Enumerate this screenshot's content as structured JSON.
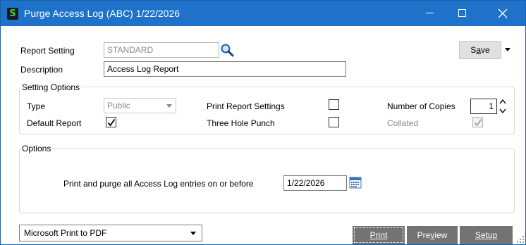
{
  "window": {
    "app_icon_letter": "S",
    "title": "Purge Access Log (ABC) 1/22/2026"
  },
  "report": {
    "setting_label": "Report Setting",
    "setting_value": "STANDARD",
    "description_label": "Description",
    "description_value": "Access Log Report",
    "save_label_prefix": "S",
    "save_label_underline": "a",
    "save_label_suffix": "ve"
  },
  "setting_options": {
    "group_label": "Setting Options",
    "type_label": "Type",
    "type_value": "Public",
    "default_report_label": "Default Report",
    "default_report_checked": true,
    "print_report_settings_label": "Print Report Settings",
    "print_report_settings_checked": false,
    "three_hole_punch_label": "Three Hole Punch",
    "three_hole_punch_checked": false,
    "copies_label": "Number of Copies",
    "copies_value": "1",
    "collated_label": "Collated",
    "collated_checked": true
  },
  "options": {
    "group_label": "Options",
    "purge_label": "Print and purge all Access Log entries on or before",
    "purge_date": "1/22/2026"
  },
  "footer": {
    "printer_value": "Microsoft Print to PDF",
    "print_label": "Print",
    "preview_prefix": "Pre",
    "preview_underline": "v",
    "preview_suffix": "iew",
    "setup_label": "Setup"
  },
  "colors": {
    "titlebar": "#1e72c9",
    "action_button": "#737373"
  }
}
